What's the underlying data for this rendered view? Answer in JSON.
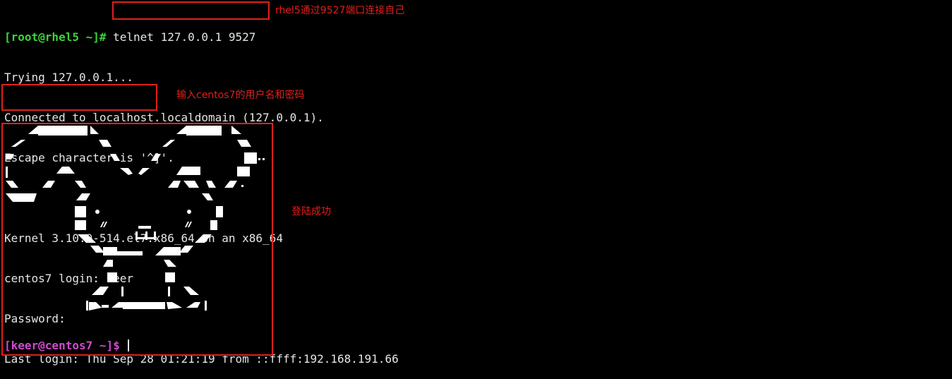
{
  "terminal": {
    "line1": {
      "prompt": "[root@rhel5 ~]#",
      "command": " telnet 127.0.0.1 9527"
    },
    "lines": [
      "Trying 127.0.0.1...",
      "Connected to localhost.localdomain (127.0.0.1).",
      "Escape character is '^]'.",
      "",
      "Kernel 3.10.0-514.el7.x86_64 on an x86_64",
      "centos7 login: keer",
      "Password:",
      "Last login: Thu Sep 28 01:21:19 from ::ffff:192.168.191.66"
    ],
    "final_prompt": "[keer@centos7 ~]$"
  },
  "annotations": {
    "connect": "rhel5通过9527端口连接自己",
    "credentials": "输入centos7的用户名和密码",
    "success": "登陆成功"
  },
  "colors": {
    "background": "#000000",
    "text": "#e6e6e6",
    "root_prompt": "#3ad43a",
    "user_prompt": "#d04ad0",
    "annotation": "#e0201c"
  }
}
